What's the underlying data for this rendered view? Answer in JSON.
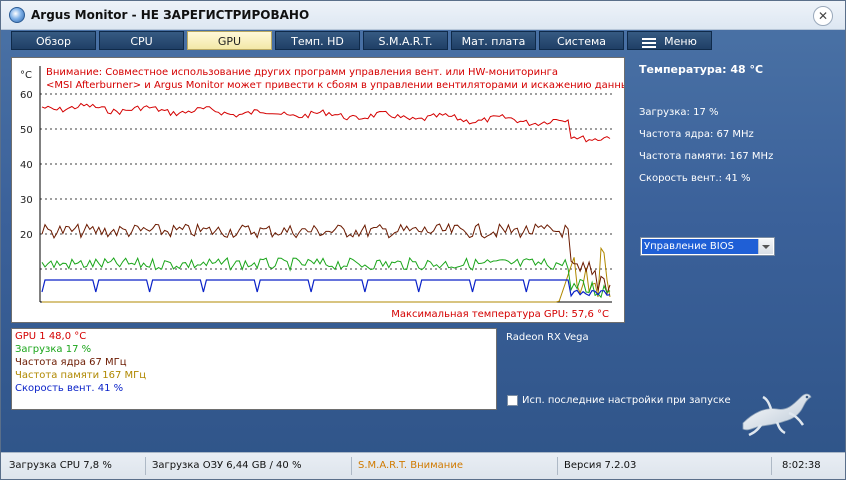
{
  "window": {
    "title": "Argus Monitor - НЕ ЗАРЕГИСТРИРОВАНО",
    "close_glyph": "✕"
  },
  "tabs": [
    {
      "label": "Обзор",
      "active": false
    },
    {
      "label": "CPU",
      "active": false
    },
    {
      "label": "GPU",
      "active": true
    },
    {
      "label": "Темп. HD",
      "active": false
    },
    {
      "label": "S.M.A.R.T.",
      "active": false
    },
    {
      "label": "Мат. плата",
      "active": false
    },
    {
      "label": "Система",
      "active": false
    },
    {
      "label": "Меню",
      "active": false,
      "icon": "hamburger-icon"
    }
  ],
  "graph": {
    "unit_label": "°C",
    "y_ticks": [
      60,
      50,
      40,
      30,
      20
    ],
    "warning_line1": "Внимание: Совместное использование других программ управления вент. или HW-мониторинга",
    "warning_line2": "<MSI Afterburner> и Argus Monitor может привести к сбоям в управлении вентиляторами и искажению данных.",
    "max_temp_label": "Максимальная температура GPU: 57,6 °C",
    "colors": {
      "temperature": "#d40000",
      "load": "#1aa51a",
      "core_clock": "#6b1a00",
      "mem_clock": "#b08800",
      "fan": "#0a22c8"
    }
  },
  "legend": [
    {
      "text": "GPU 1 48,0 °C",
      "color": "#d40000"
    },
    {
      "text": "Загрузка 17 %",
      "color": "#1aa51a"
    },
    {
      "text": "Частота ядра 67 МГц",
      "color": "#6b1a00"
    },
    {
      "text": "Частота памяти 167 МГц",
      "color": "#b08800"
    },
    {
      "text": "Скорость вент. 41 %",
      "color": "#0a22c8"
    }
  ],
  "gpu_name": "Radeon RX Vega",
  "right_panel": {
    "temperature": "Температура: 48 °C",
    "load": "Загрузка: 17 %",
    "core_clock": "Частота ядра: 67 MHz",
    "mem_clock": "Частота памяти: 167 MHz",
    "fan_speed": "Скорость вент.: 41 %",
    "dropdown_value": "Управление BIOS"
  },
  "checkbox": {
    "label": "Исп. последние настройки при запуске",
    "checked": false
  },
  "status_bar": {
    "cpu_load": "Загрузка CPU 7,8 %",
    "ram_load": "Загрузка ОЗУ 6,44 GB / 40 %",
    "smart": "S.M.A.R.T. Внимание",
    "version": "Версия 7.2.03",
    "time": "8:02:38"
  }
}
